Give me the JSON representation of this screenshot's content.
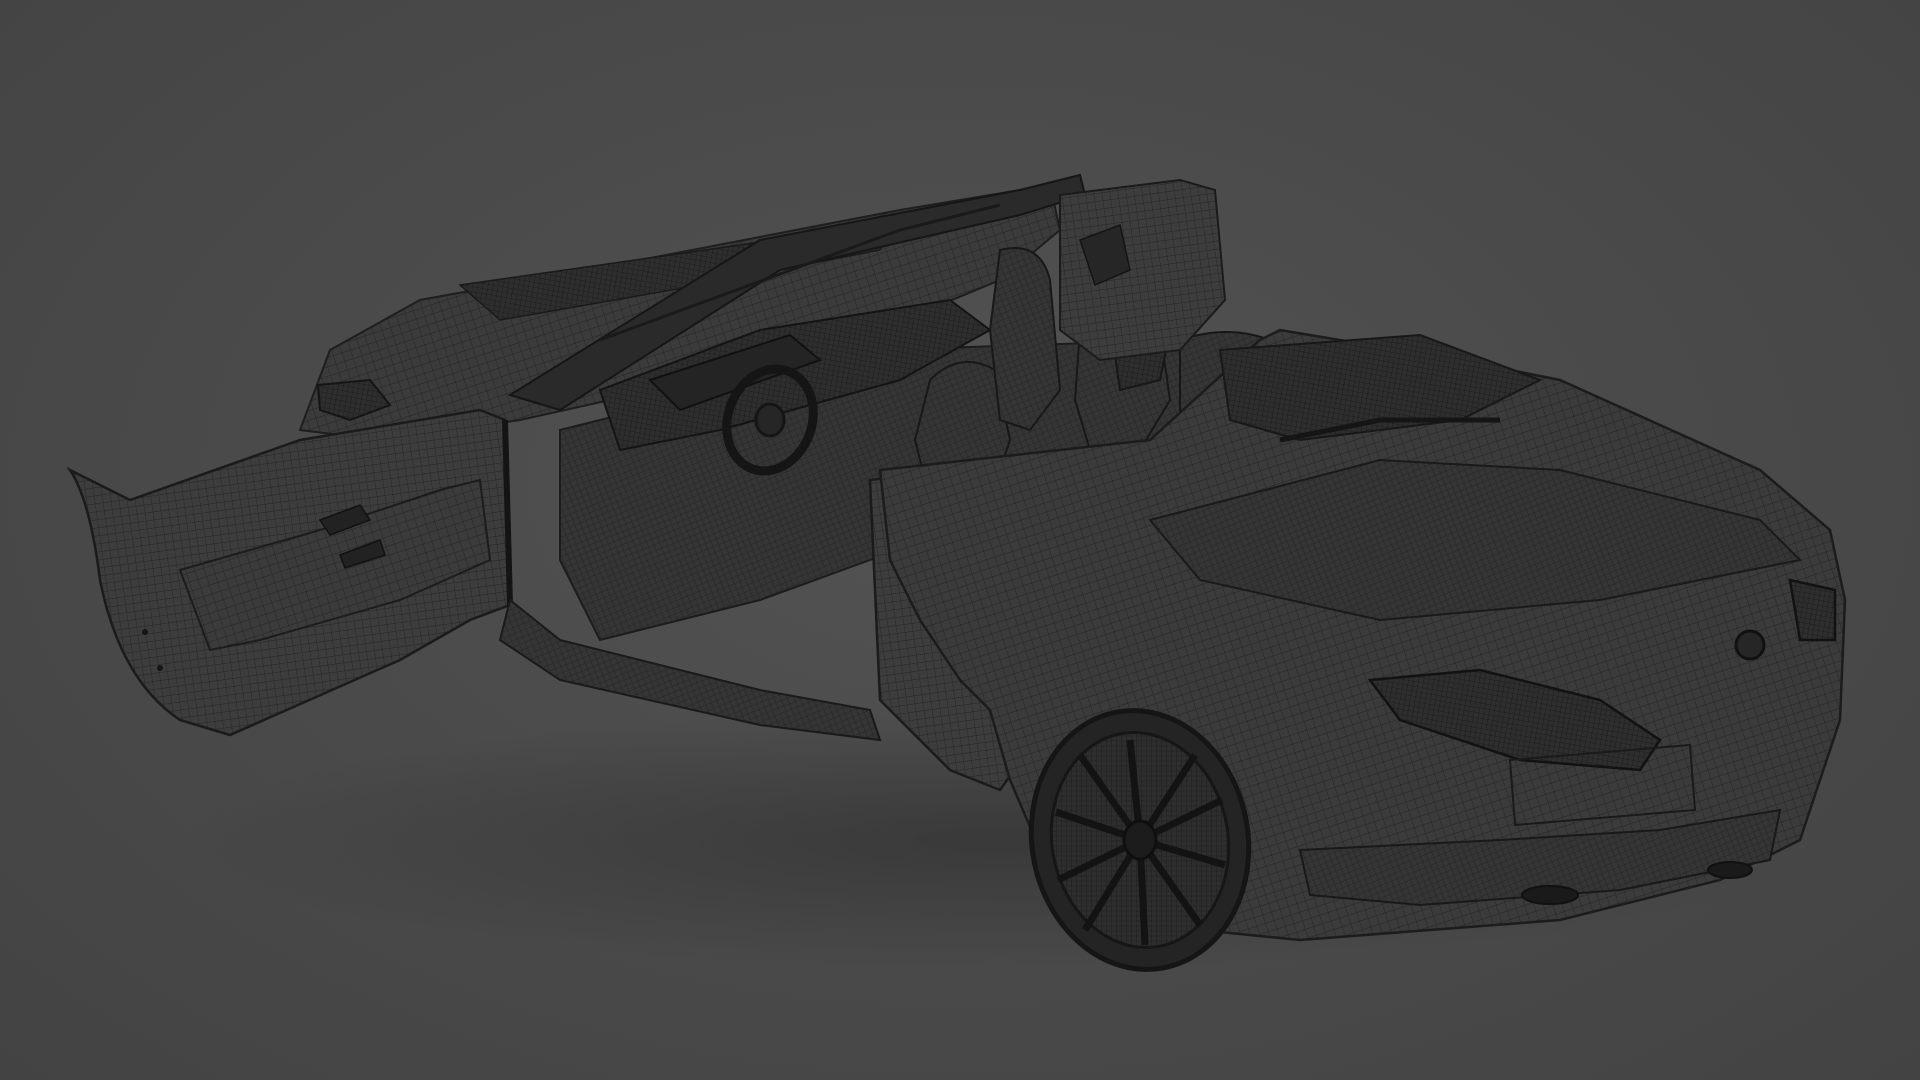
{
  "scene": {
    "subject_icon": "convertible-car-wireframe-icon",
    "colors": {
      "background": "#4a4a4a",
      "body_fill": "#3a3a3a",
      "wire": "#1e1e1e",
      "shade": "#2c2c2c"
    }
  }
}
